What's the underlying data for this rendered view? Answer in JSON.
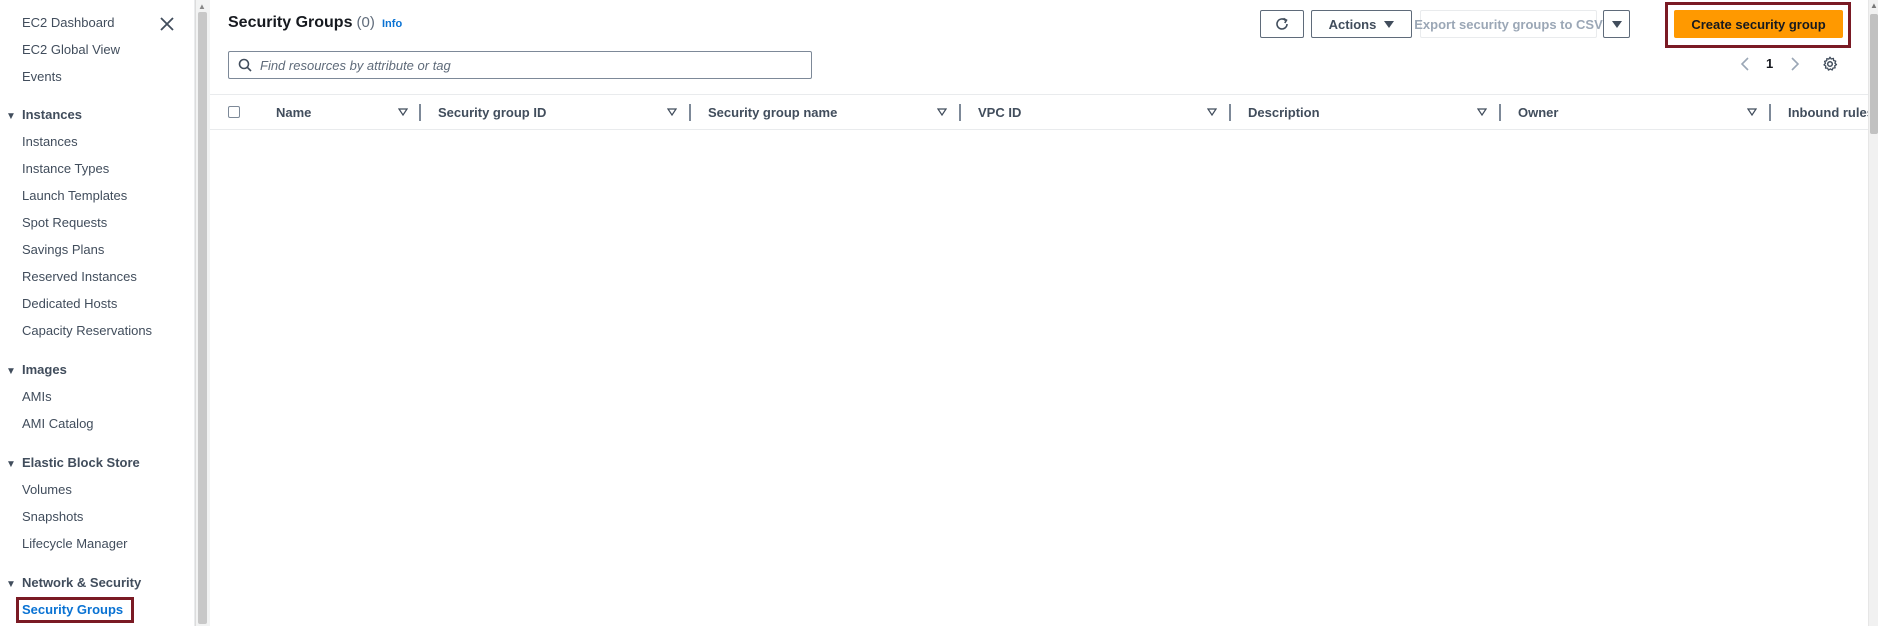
{
  "sidebar": {
    "top_links": [
      "EC2 Dashboard",
      "EC2 Global View",
      "Events"
    ],
    "sections": [
      {
        "title": "Instances",
        "items": [
          "Instances",
          "Instance Types",
          "Launch Templates",
          "Spot Requests",
          "Savings Plans",
          "Reserved Instances",
          "Dedicated Hosts",
          "Capacity Reservations"
        ]
      },
      {
        "title": "Images",
        "items": [
          "AMIs",
          "AMI Catalog"
        ]
      },
      {
        "title": "Elastic Block Store",
        "items": [
          "Volumes",
          "Snapshots",
          "Lifecycle Manager"
        ]
      },
      {
        "title": "Network & Security",
        "items": [
          "Security Groups"
        ]
      }
    ],
    "active_item": "Security Groups"
  },
  "header": {
    "title": "Security Groups",
    "count": "(0)",
    "info_label": "Info"
  },
  "toolbar": {
    "actions_label": "Actions",
    "export_label": "Export security groups to CSV",
    "create_label": "Create security group"
  },
  "search": {
    "placeholder": "Find resources by attribute or tag",
    "value": ""
  },
  "pagination": {
    "current_page": "1"
  },
  "table": {
    "columns": [
      "Name",
      "Security group ID",
      "Security group name",
      "VPC ID",
      "Description",
      "Owner",
      "Inbound rules"
    ]
  },
  "colors": {
    "accent": "#0972d3",
    "primary_button": "#ff9900",
    "highlight_outline": "#7a1a24"
  }
}
